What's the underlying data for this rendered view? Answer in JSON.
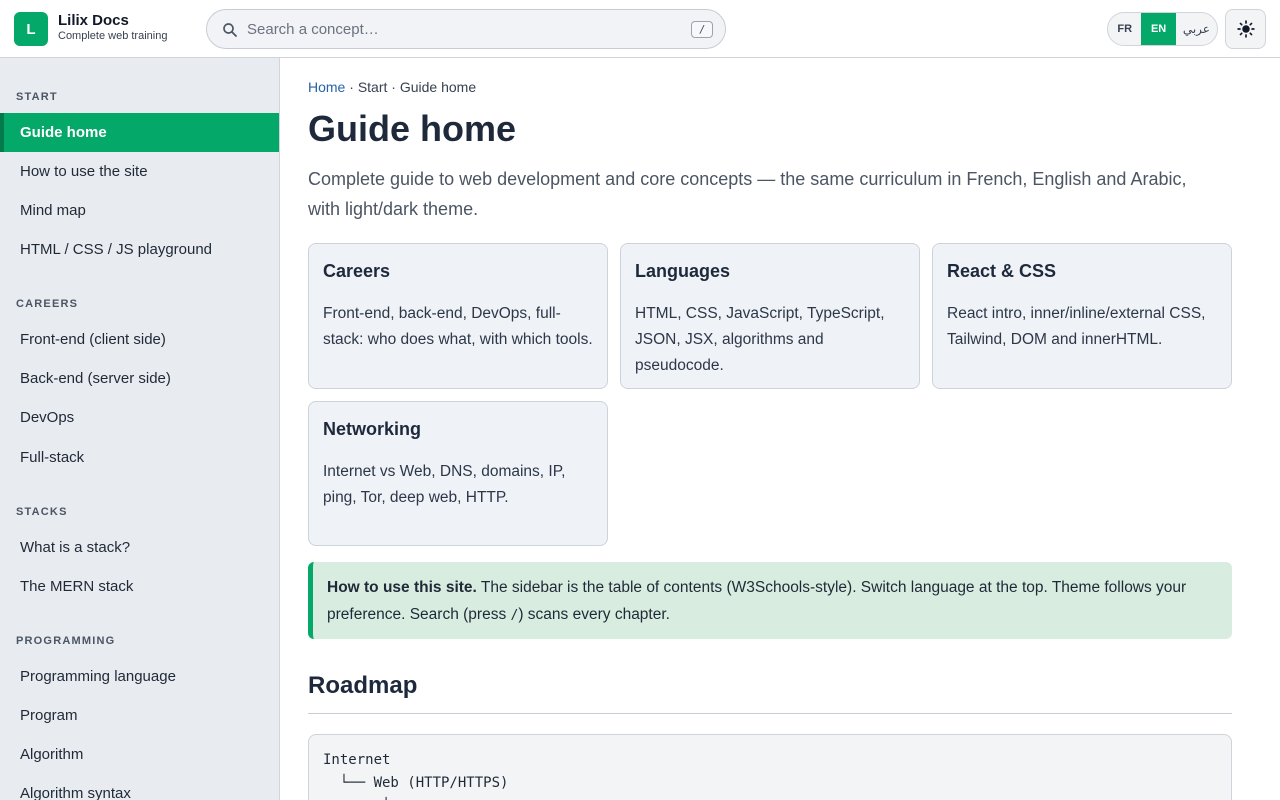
{
  "header": {
    "logo_letter": "L",
    "brand_name": "Lilix Docs",
    "brand_sub": "Complete web training",
    "search_placeholder": "Search a concept…",
    "search_shortcut": "/",
    "languages": [
      "FR",
      "EN",
      "عربي"
    ],
    "active_language": "EN",
    "theme_icon": "sun-icon"
  },
  "sidebar": {
    "sections": [
      {
        "title": "START",
        "items": [
          "Guide home",
          "How to use the site",
          "Mind map",
          "HTML / CSS / JS playground"
        ]
      },
      {
        "title": "CAREERS",
        "items": [
          "Front-end (client side)",
          "Back-end (server side)",
          "DevOps",
          "Full-stack"
        ]
      },
      {
        "title": "STACKS",
        "items": [
          "What is a stack?",
          "The MERN stack"
        ]
      },
      {
        "title": "PROGRAMMING",
        "items": [
          "Programming language",
          "Program",
          "Algorithm",
          "Algorithm syntax"
        ]
      }
    ],
    "active_item": "Guide home"
  },
  "main": {
    "breadcrumb": {
      "home": "Home",
      "sep": " · ",
      "section": "Start",
      "page": "Guide home"
    },
    "title": "Guide home",
    "intro": "Complete guide to web development and core concepts — the same curriculum in French, English and Arabic, with light/dark theme.",
    "cards": [
      {
        "title": "Careers",
        "text": "Front-end, back-end, DevOps, full-stack: who does what, with which tools."
      },
      {
        "title": "Languages",
        "text": "HTML, CSS, JavaScript, TypeScript, JSON, JSX, algorithms and pseudocode."
      },
      {
        "title": "React & CSS",
        "text": "React intro, inner/inline/external CSS, Tailwind, DOM and innerHTML."
      },
      {
        "title": "Networking",
        "text": "Internet vs Web, DNS, domains, IP, ping, Tor, deep web, HTTP."
      }
    ],
    "callout": {
      "bold": "How to use this site.",
      "text_before_key": " The sidebar is the table of contents (W3Schools-style). Switch language at the top. Theme follows your preference. Search (press ",
      "key": "/",
      "text_after_key": ") scans every chapter."
    },
    "roadmap_heading": "Roadmap",
    "roadmap_lines": [
      "Internet",
      "  └── Web (HTTP/HTTPS)",
      "       │"
    ]
  },
  "colors": {
    "accent": "#04a868",
    "callout_bg": "#d8ede0",
    "card_bg": "#eff2f7",
    "sidebar_bg": "#e8ebef"
  }
}
